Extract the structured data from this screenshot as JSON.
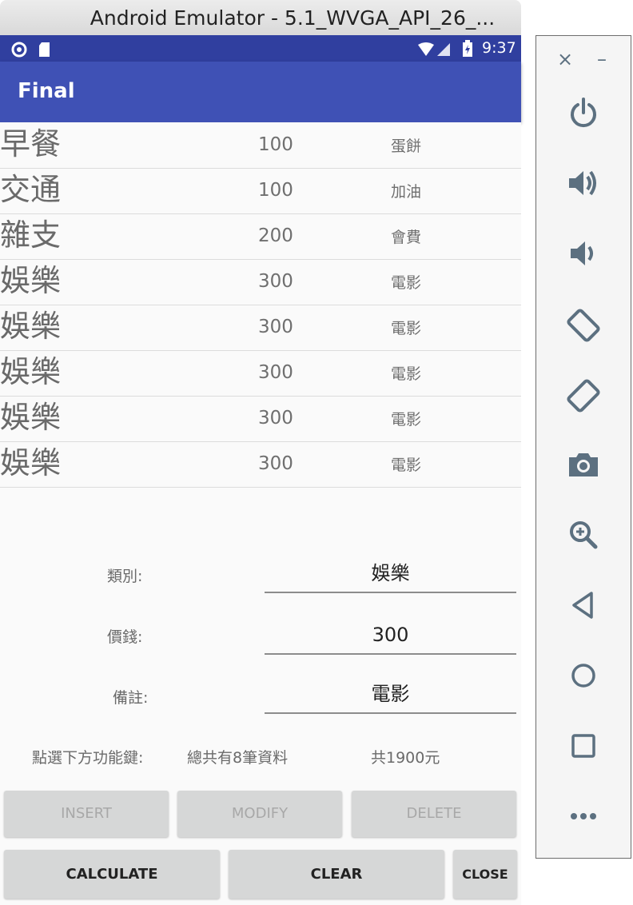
{
  "window": {
    "title": "Android Emulator - 5.1_WVGA_API_26_..."
  },
  "status_bar": {
    "time": "9:37"
  },
  "app_bar": {
    "title": "Final"
  },
  "records": [
    {
      "category": "早餐",
      "amount": "100",
      "note": "蛋餅"
    },
    {
      "category": "交通",
      "amount": "100",
      "note": "加油"
    },
    {
      "category": "雜支",
      "amount": "200",
      "note": "會費"
    },
    {
      "category": "娛樂",
      "amount": "300",
      "note": "電影"
    },
    {
      "category": "娛樂",
      "amount": "300",
      "note": "電影"
    },
    {
      "category": "娛樂",
      "amount": "300",
      "note": "電影"
    },
    {
      "category": "娛樂",
      "amount": "300",
      "note": "電影"
    },
    {
      "category": "娛樂",
      "amount": "300",
      "note": "電影"
    }
  ],
  "form": {
    "category_label": "類別:",
    "category_value": "娛樂",
    "price_label": "價錢:",
    "price_value": "300",
    "note_label": "備註:",
    "note_value": "電影"
  },
  "summary": {
    "prompt": "點選下方功能鍵:",
    "count": "總共有8筆資料",
    "total": "共1900元"
  },
  "buttons": {
    "insert": "INSERT",
    "modify": "MODIFY",
    "delete": "DELETE",
    "calculate": "CALCULATE",
    "clear": "CLEAR",
    "close": "CLOSE"
  },
  "side_panel": {
    "close": "×",
    "minimize": "–",
    "icons": [
      "power-icon",
      "volume-up-icon",
      "volume-down-icon",
      "rotate-left-icon",
      "rotate-right-icon",
      "camera-icon",
      "zoom-icon",
      "back-icon",
      "home-icon",
      "overview-icon",
      "more-icon"
    ]
  }
}
